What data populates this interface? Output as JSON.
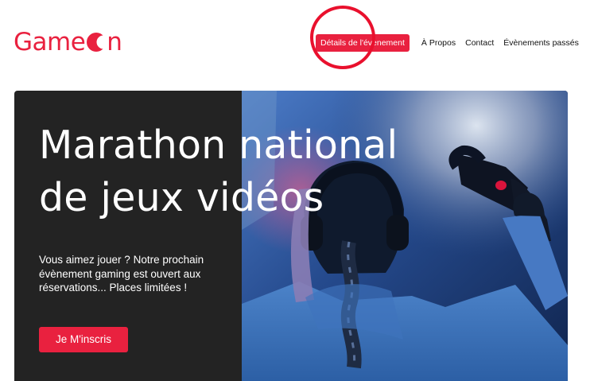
{
  "brand": {
    "logo_prefix": "Game",
    "logo_suffix": "n",
    "color": "#e9213f"
  },
  "nav": {
    "items": [
      {
        "label": "Détails de l'évènement",
        "active": true
      },
      {
        "label": "À Propos",
        "active": false
      },
      {
        "label": "Contact",
        "active": false
      },
      {
        "label": "Évènements passés",
        "active": false
      }
    ]
  },
  "hero": {
    "title_line1": "Marathon national",
    "title_line2": "de jeux vidéos",
    "text_line1": "Vous aimez jouer ? Notre prochain",
    "text_line2": "évènement gaming est ouvert aux",
    "text_line3": "réservations... Places limitées !",
    "cta_label": "Je M'inscris",
    "image_subject": "player-with-headset-and-controller"
  },
  "colors": {
    "accent": "#e9213f",
    "annotation": "#e9102d",
    "hero_dark": "#232323"
  }
}
